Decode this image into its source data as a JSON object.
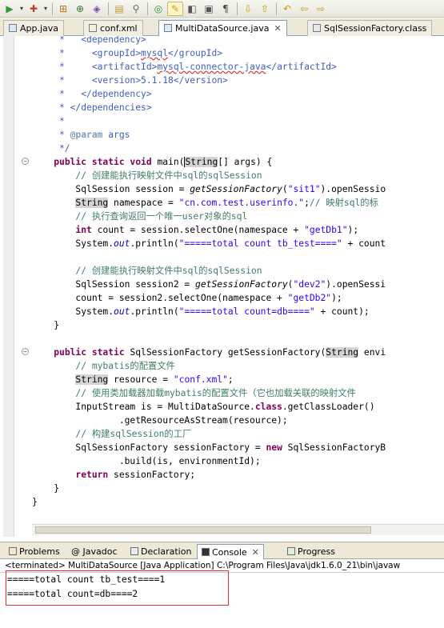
{
  "toolbar": {
    "icons": [
      "run-icon",
      "run-dropdown-icon",
      "debug-icon",
      "debug-dropdown-icon",
      "new-java-project-icon",
      "new-class-icon",
      "open-type-icon",
      "open-folder-icon",
      "search-icon",
      "target-icon",
      "highlight-pen-icon",
      "mark-occurrences-icon",
      "toggle-whitespace-icon",
      "show-whitespace-icon",
      "next-annotation-icon",
      "previous-annotation-icon",
      "last-edit-icon",
      "back-icon",
      "forward-icon"
    ]
  },
  "editor_tabs": [
    {
      "label": "App.java"
    },
    {
      "label": "conf.xml"
    },
    {
      "label": "MultiDataSource.java",
      "close": "✕"
    },
    {
      "label": "SqlSessionFactory.class"
    }
  ],
  "code": {
    "l1": "     *   <dependency>",
    "l2a": "     *     <groupId>",
    "l2b": "mysql",
    "l2c": "</groupId>",
    "l3a": "     *     <artifactId>",
    "l3b": "mysql-connector-java",
    "l3c": "</artifactId>",
    "l4a": "     *     <version>",
    "l4b": "5.1.18",
    "l4c": "</version>",
    "l5": "     *   </dependency>",
    "l6": "     * </dependencies>",
    "l7": "     *",
    "l8a": "     * ",
    "l8b": "@param",
    "l8c": " args",
    "l9": "     */",
    "l10a": "    ",
    "l10kw": "public static void",
    "l10b": " main(",
    "l10h": "String",
    "l10c": "[] args) {",
    "l11": "        // 创建能执行映射文件中sql的sqlSession",
    "l12a": "        SqlSession session = ",
    "l12m": "getSessionFactory",
    "l12b": "(",
    "l12s": "\"sit1\"",
    "l12c": ").openSessio",
    "l13a": "        ",
    "l13h": "String",
    "l13b": " namespace = ",
    "l13s": "\"cn.com.test.userinfo.\"",
    "l13c": ";",
    "l13cm": "// 映射sql的标",
    "l14": "        // 执行查询返回一个唯一user对象的sql",
    "l15a": "        ",
    "l15kw": "int",
    "l15b": " count = session.selectOne(namespace + ",
    "l15s": "\"getDb1\"",
    "l15c": ");",
    "l16a": "        System.",
    "l16f": "out",
    "l16b": ".println(",
    "l16s": "\"=====total count tb_test====\"",
    "l16c": " + count",
    "l18": "        // 创建能执行映射文件中sql的sqlSession",
    "l19a": "        SqlSession session2 = ",
    "l19m": "getSessionFactory",
    "l19b": "(",
    "l19s": "\"dev2\"",
    "l19c": ").openSessi",
    "l20a": "        count = session2.selectOne(namespace + ",
    "l20s": "\"getDb2\"",
    "l20b": ");",
    "l21a": "        System.",
    "l21f": "out",
    "l21b": ".println(",
    "l21s": "\"=====total count=db====\"",
    "l21c": " + count);",
    "l22": "    }",
    "l24a": "    ",
    "l24kw": "public static",
    "l24b": " SqlSessionFactory getSessionFactory(",
    "l24h": "String",
    "l24c": " envi",
    "l25": "        // mybatis的配置文件",
    "l26a": "        ",
    "l26h": "String",
    "l26b": " resource = ",
    "l26s": "\"conf.xml\"",
    "l26c": ";",
    "l27": "        // 使用类加载器加载mybatis的配置文件（它也加载关联的映射文件",
    "l28a": "        InputStream is = MultiDataSource.",
    "l28kw": "class",
    "l28b": ".getClassLoader()",
    "l29": "                .getResourceAsStream(resource);",
    "l30": "        // 构建sqlSession的工厂",
    "l31a": "        SqlSessionFactory sessionFactory = ",
    "l31kw": "new",
    "l31b": " SqlSessionFactoryB",
    "l32": "                .build(is, environmentId);",
    "l33a": "        ",
    "l33kw": "return",
    "l33b": " sessionFactory;",
    "l34": "    }",
    "l36": "}"
  },
  "bottom_tabs": [
    {
      "label": "Problems"
    },
    {
      "label": "@ Javadoc"
    },
    {
      "label": "Declaration"
    },
    {
      "label": "Console",
      "close": "✕"
    },
    {
      "label": "Progress"
    }
  ],
  "console": {
    "status": "<terminated> MultiDataSource [Java Application] C:\\Program Files\\Java\\jdk1.6.0_21\\bin\\javaw",
    "lines": [
      "=====total count tb_test====1",
      "=====total count=db====2"
    ]
  }
}
